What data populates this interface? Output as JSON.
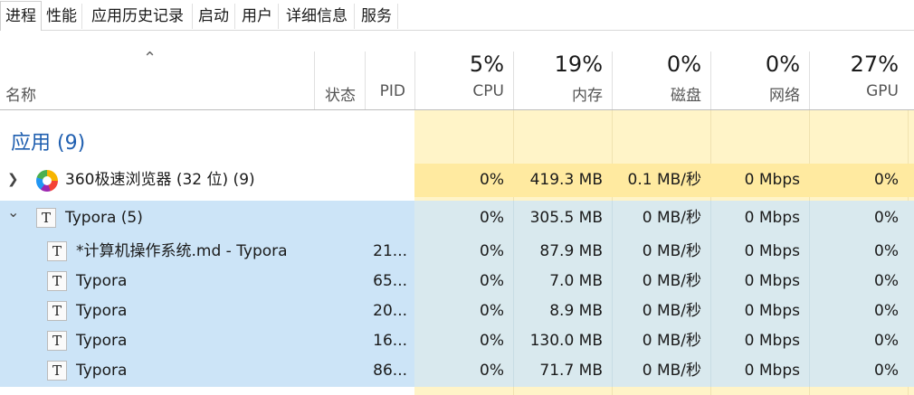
{
  "tabs": [
    "进程",
    "性能",
    "应用历史记录",
    "启动",
    "用户",
    "详细信息",
    "服务"
  ],
  "columns": {
    "name": "名称",
    "status": "状态",
    "pid": "PID",
    "cpu": {
      "pct": "5%",
      "label": "CPU"
    },
    "mem": {
      "pct": "19%",
      "label": "内存"
    },
    "disk": {
      "pct": "0%",
      "label": "磁盘"
    },
    "net": {
      "pct": "0%",
      "label": "网络"
    },
    "gpu": {
      "pct": "27%",
      "label": "GPU"
    }
  },
  "group": {
    "title": "应用 (9)"
  },
  "rows": [
    {
      "name": "360极速浏览器 (32 位) (9)",
      "pid": "",
      "cpu": "0%",
      "mem": "419.3 MB",
      "disk": "0.1 MB/秒",
      "net": "0 Mbps",
      "gpu": "0%"
    },
    {
      "name": "Typora (5)",
      "pid": "",
      "cpu": "0%",
      "mem": "305.5 MB",
      "disk": "0 MB/秒",
      "net": "0 Mbps",
      "gpu": "0%"
    },
    {
      "name": "*计算机操作系统.md - Typora",
      "pid": "21...",
      "cpu": "0%",
      "mem": "87.9 MB",
      "disk": "0 MB/秒",
      "net": "0 Mbps",
      "gpu": "0%"
    },
    {
      "name": "Typora",
      "pid": "65...",
      "cpu": "0%",
      "mem": "7.0 MB",
      "disk": "0 MB/秒",
      "net": "0 Mbps",
      "gpu": "0%"
    },
    {
      "name": "Typora",
      "pid": "20...",
      "cpu": "0%",
      "mem": "8.9 MB",
      "disk": "0 MB/秒",
      "net": "0 Mbps",
      "gpu": "0%"
    },
    {
      "name": "Typora",
      "pid": "16...",
      "cpu": "0%",
      "mem": "130.0 MB",
      "disk": "0 MB/秒",
      "net": "0 Mbps",
      "gpu": "0%"
    },
    {
      "name": "Typora",
      "pid": "86...",
      "cpu": "0%",
      "mem": "71.7 MB",
      "disk": "0 MB/秒",
      "net": "0 Mbps",
      "gpu": "0%"
    }
  ],
  "icons": {
    "expand": "chevron-right-icon",
    "collapse": "chevron-down-icon",
    "sort": "sort-up-icon",
    "app": "typora-icon",
    "browser": "browser-icon"
  },
  "colors": {
    "heat_light": "#fff4c8",
    "heat_strong": "#ffeaa0",
    "selection": "#cce4f7",
    "group_title": "#1f5fb0"
  }
}
